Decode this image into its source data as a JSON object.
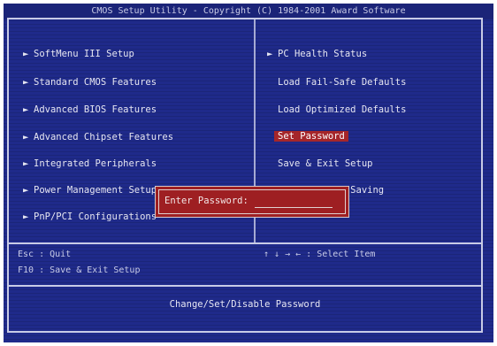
{
  "title": "CMOS Setup Utility - Copyright (C) 1984-2001 Award Software",
  "menu_left": [
    {
      "marker": "►",
      "label": "SoftMenu III Setup"
    },
    {
      "marker": "►",
      "label": "Standard CMOS Features"
    },
    {
      "marker": "►",
      "label": "Advanced BIOS Features"
    },
    {
      "marker": "►",
      "label": "Advanced Chipset Features"
    },
    {
      "marker": "►",
      "label": "Integrated Peripherals"
    },
    {
      "marker": "►",
      "label": "Power Management Setup"
    },
    {
      "marker": "►",
      "label": "PnP/PCI Configurations"
    }
  ],
  "menu_right": [
    {
      "marker": "►",
      "label": "PC Health Status"
    },
    {
      "marker": "",
      "label": "Load Fail-Safe Defaults"
    },
    {
      "marker": "",
      "label": "Load Optimized Defaults"
    },
    {
      "marker": "",
      "label": "Set Password",
      "selected": true
    },
    {
      "marker": "",
      "label": "Save & Exit Setup"
    },
    {
      "marker": "",
      "label": "Exit Without Saving"
    }
  ],
  "dialog": {
    "prompt": "Enter Password:",
    "value": ""
  },
  "help": {
    "esc": "Esc : Quit",
    "arrows": "↑ ↓ → ←   : Select Item",
    "f10": "F10 : Save & Exit Setup"
  },
  "status_text": "Change/Set/Disable Password",
  "colors": {
    "background": "#1f2a8a",
    "selection": "#a5262a",
    "dialog": "#9e1f22",
    "text": "#e6e6f2"
  }
}
